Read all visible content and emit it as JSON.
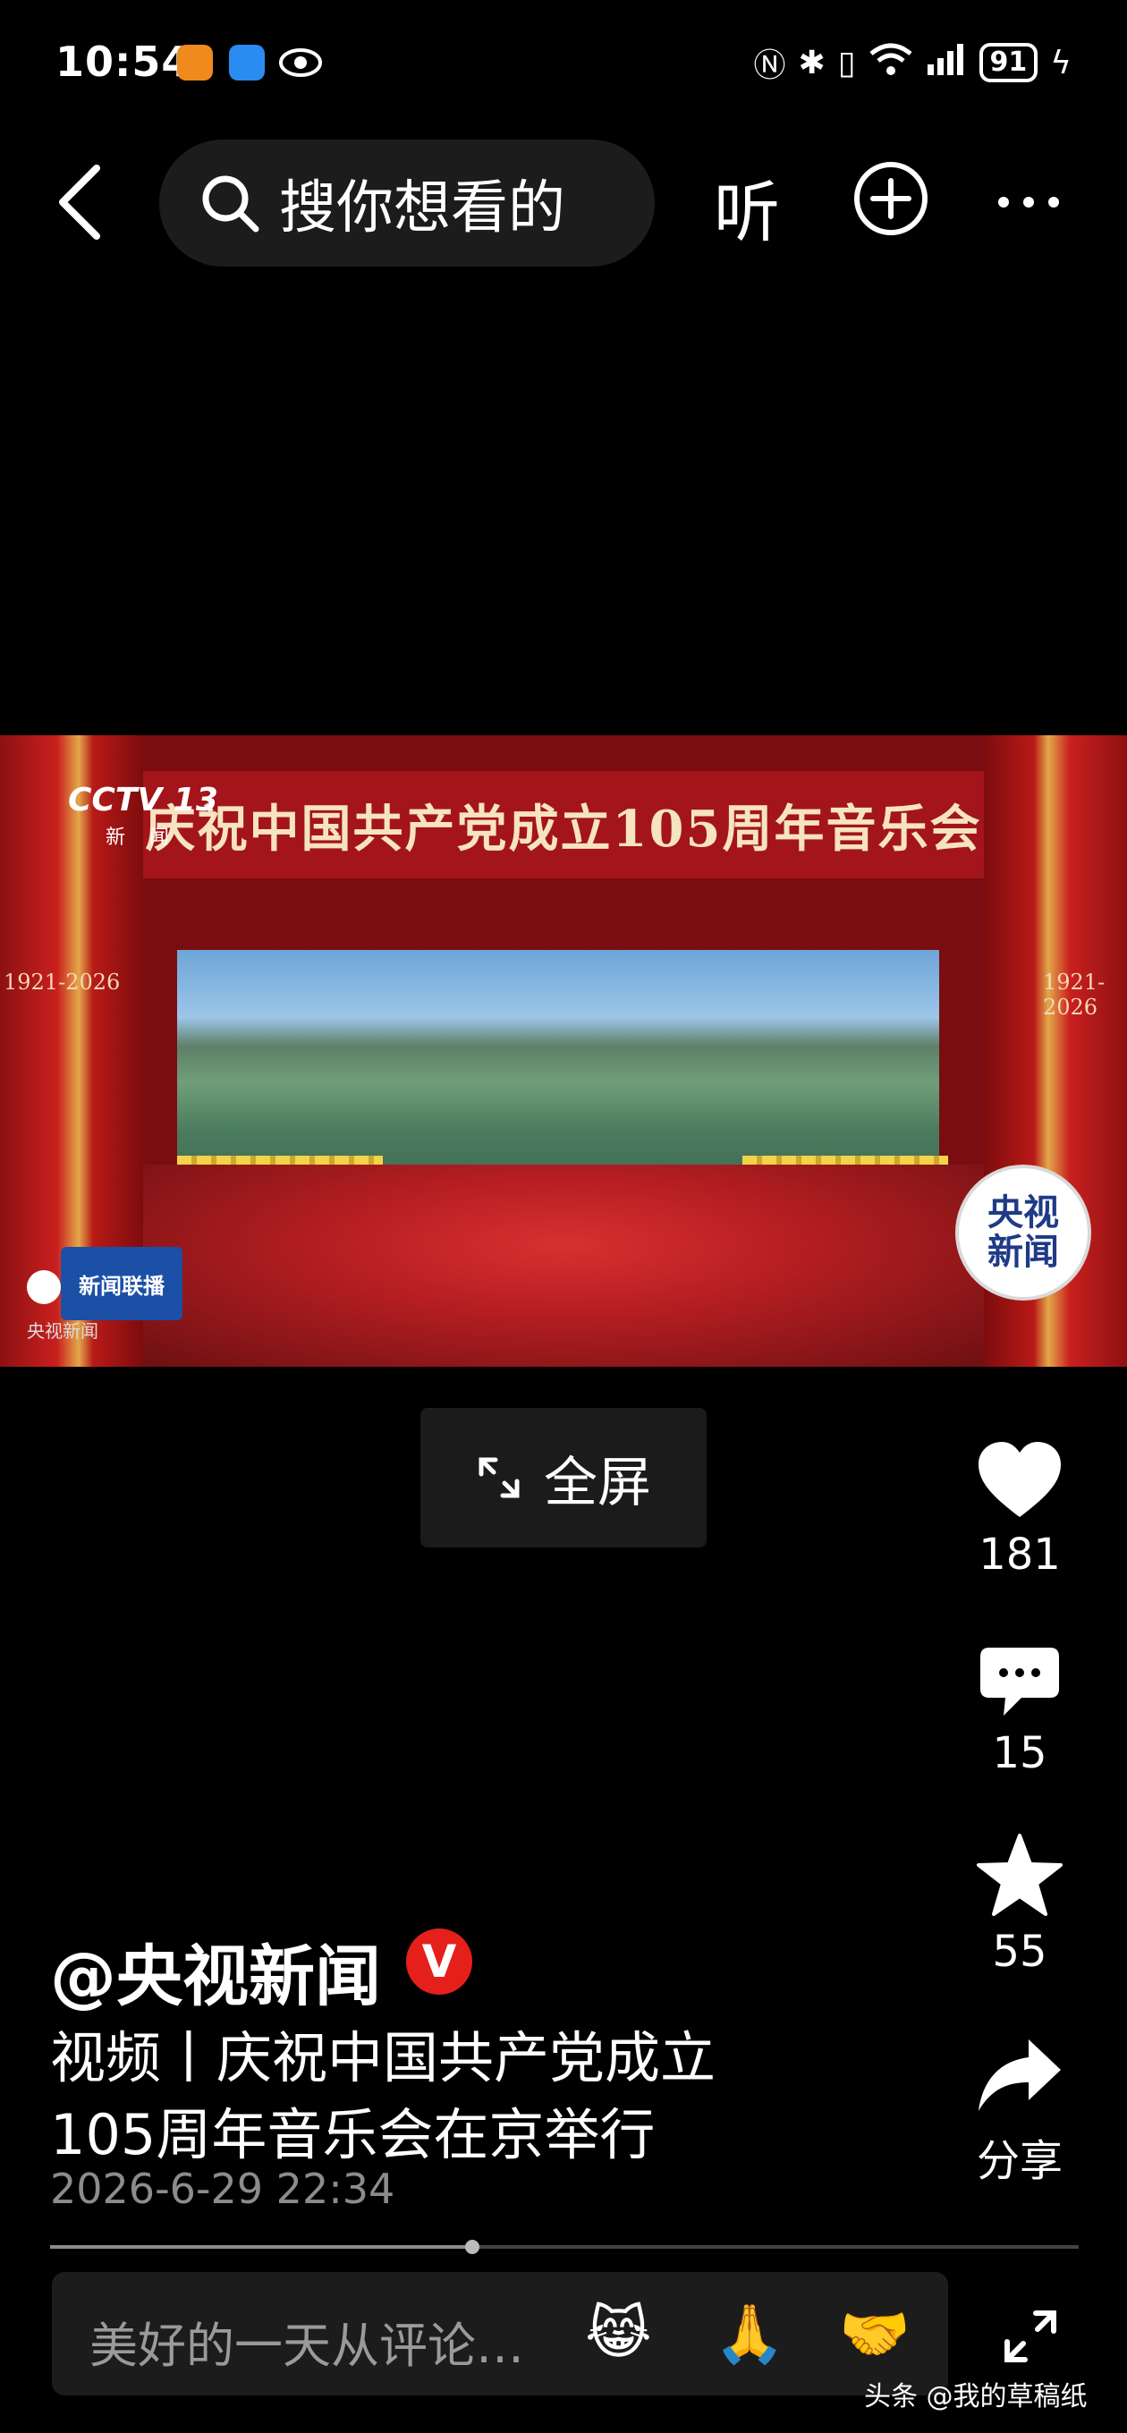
{
  "status_bar": {
    "time": "10:54",
    "battery": "91"
  },
  "top_bar": {
    "search_placeholder": "搜你想看的",
    "listen_label": "听"
  },
  "video": {
    "channel_logo": "CCTV 13",
    "channel_sub": "新 闻",
    "banner_text": "庆祝中国共产党成立105周年音乐会",
    "years_left": "1921-2026",
    "years_right": "1921-2026",
    "news_badge": "央视新闻",
    "program_logo": "新闻联播",
    "source_text": "央视新闻"
  },
  "fullscreen_label": "全屏",
  "actions": {
    "like_count": "181",
    "comment_count": "15",
    "favorite_count": "55",
    "share_label": "分享"
  },
  "post": {
    "author": "@央视新闻",
    "title_line1": "视频丨庆祝中国共产党成立",
    "title_line2": "105周年音乐会在京举行",
    "date": "2026-6-29 22:34"
  },
  "progress": 0.41,
  "comment": {
    "placeholder": "美好的一天从评论…",
    "emojis": [
      "😹",
      "🙏",
      "🤝"
    ]
  },
  "watermark": "头条 @我的草稿纸",
  "colors": {
    "background": "#000000",
    "verified": "#e5201b"
  }
}
